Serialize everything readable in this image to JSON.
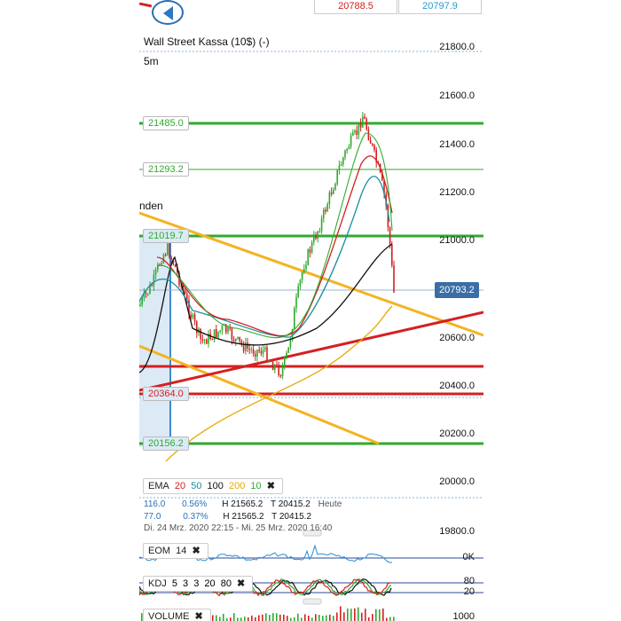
{
  "header": {
    "bid": "20788.5",
    "ask": "20797.9",
    "bid_color": "#cc2222",
    "ask_color": "#2a9ad0"
  },
  "instrument": {
    "name": "Wall Street Kassa (10$) (-)",
    "timeframe": "5m",
    "partial_label": "nden"
  },
  "y_axis": {
    "ticks": [
      "21800.0",
      "21600.0",
      "21400.0",
      "21200.0",
      "21000.0",
      "20600.0",
      "20400.0",
      "20200.0",
      "20000.0",
      "19800.0"
    ],
    "current_price": "20793.2"
  },
  "levels": {
    "l1": "21485.0",
    "l2": "21293.2",
    "l3": "21019.7",
    "l4": "20364.0",
    "l5": "20156.2"
  },
  "ema": {
    "label": "EMA",
    "periods": [
      {
        "value": "20",
        "color": "#d42020"
      },
      {
        "value": "50",
        "color": "#1c8fa0"
      },
      {
        "value": "100",
        "color": "#111111"
      },
      {
        "value": "200",
        "color": "#e8a800"
      },
      {
        "value": "10",
        "color": "#2faa2f"
      }
    ]
  },
  "stats": {
    "row1": {
      "a": "116.0",
      "b": "0.56%",
      "c": "H 21565.2",
      "d": "T 20415.2",
      "e": "Heute"
    },
    "row2": {
      "a": "77.0",
      "b": "0.37%",
      "c": "H 21565.2",
      "d": "T 20415.2"
    },
    "date_range": "Di. 24 Mrz. 2020 22:15 - Mi. 25 Mrz. 2020 16:40"
  },
  "eom": {
    "label": "EOM",
    "period": "14",
    "axis": "0K"
  },
  "kdj": {
    "label": "KDJ",
    "params": [
      "5",
      "3",
      "3",
      "20",
      "80"
    ],
    "axis_hi": "80",
    "axis_lo": "20"
  },
  "volume": {
    "label": "VOLUME",
    "axis": "1000"
  },
  "icons": {
    "back": "left-arrow-icon",
    "close": "close-icon"
  },
  "close_glyph": "✖"
}
